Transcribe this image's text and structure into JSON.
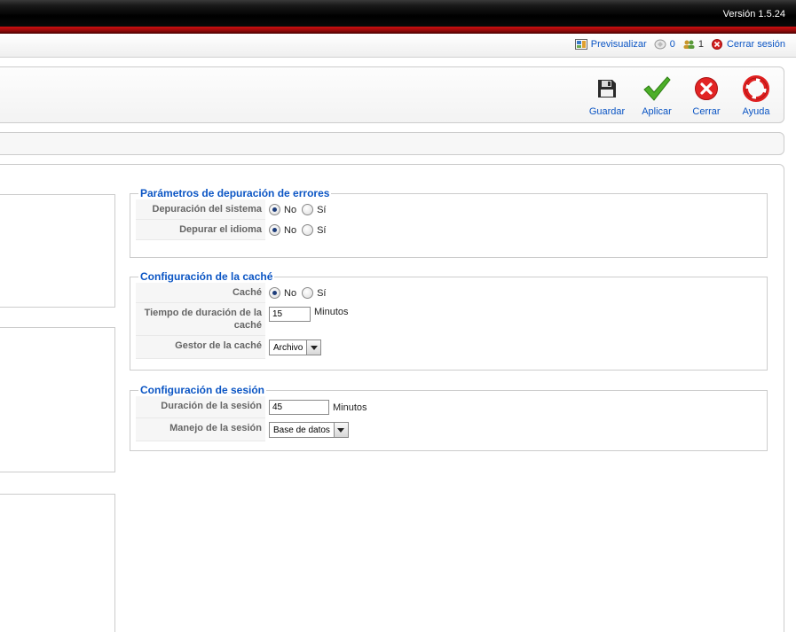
{
  "header": {
    "version": "Versión 1.5.24"
  },
  "statusbar": {
    "preview": "Previsualizar",
    "messages": "0",
    "users": "1",
    "logout": "Cerrar sesión"
  },
  "toolbar": {
    "save": "Guardar",
    "apply": "Aplicar",
    "close": "Cerrar",
    "help": "Ayuda"
  },
  "debug": {
    "legend": "Parámetros de depuración de errores",
    "system_label": "Depuración del sistema",
    "language_label": "Depurar el idioma",
    "no": "No",
    "yes": "Sí",
    "system_value": "No",
    "language_value": "No"
  },
  "cache": {
    "legend": "Configuración de la caché",
    "cache_label": "Caché",
    "time_label": "Tiempo de duración de la caché",
    "time_value": "15",
    "time_unit": "Minutos",
    "handler_label": "Gestor de la caché",
    "handler_value": "Archivo",
    "no": "No",
    "yes": "Sí",
    "cache_value": "No"
  },
  "session": {
    "legend": "Configuración de sesión",
    "lifetime_label": "Duración de la sesión",
    "lifetime_value": "45",
    "lifetime_unit": "Minutos",
    "handler_label": "Manejo de la sesión",
    "handler_value": "Base de datos"
  },
  "colors": {
    "link": "#0b55c4",
    "header_red": "#d10f10"
  }
}
